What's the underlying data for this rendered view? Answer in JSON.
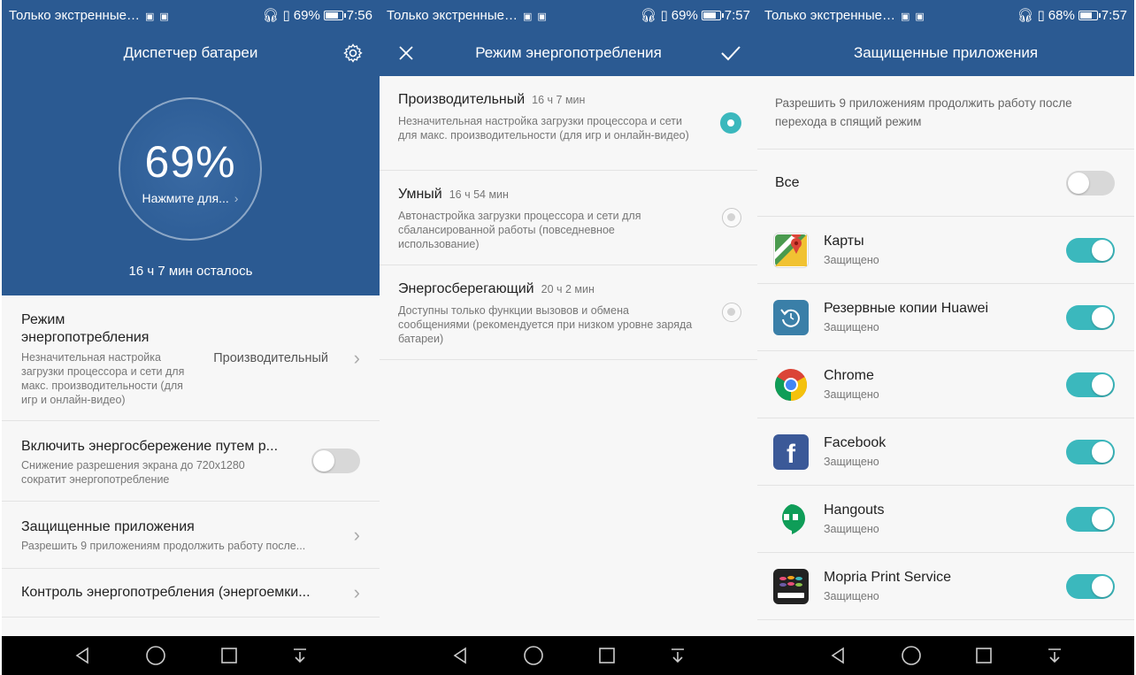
{
  "status_bars": [
    {
      "carrier": "Только экстренные…",
      "battery": "69%",
      "time": "7:56",
      "level": 0.69
    },
    {
      "carrier": "Только экстренные…",
      "battery": "69%",
      "time": "7:57",
      "level": 0.69
    },
    {
      "carrier": "Только экстренные…",
      "battery": "68%",
      "time": "7:57",
      "level": 0.68
    }
  ],
  "screen1": {
    "title": "Диспетчер батареи",
    "percent": "69%",
    "tap_label": "Нажмите для...",
    "remaining": "16 ч 7 мин осталось",
    "power_mode": {
      "title": "Режим энергопотребления",
      "desc": "Незначительная настройка загрузки процессора и сети для макс. производительности (для игр и онлайн-видео)",
      "value": "Производительный"
    },
    "resolution": {
      "title": "Включить энергосбережение путем р...",
      "desc": "Снижение разрешения экрана до 720x1280 сократит энергопотребление",
      "enabled": false
    },
    "protected": {
      "title": "Защищенные приложения",
      "desc": "Разрешить 9 приложениям продолжить работу после..."
    },
    "consumption": {
      "title": "Контроль энергопотребления (энергоемки..."
    }
  },
  "screen2": {
    "title": "Режим энергопотребления",
    "modes": [
      {
        "name": "Производительный",
        "time": "16 ч 7 мин",
        "desc": "Незначительная настройка загрузки процессора и сети для макс. производительности (для игр и онлайн-видео)",
        "selected": true
      },
      {
        "name": "Умный",
        "time": "16 ч 54 мин",
        "desc": "Автонастройка загрузки процессора и сети для сбалансированной работы (повседневное использование)",
        "selected": false
      },
      {
        "name": "Энергосберегающий",
        "time": "20 ч 2 мин",
        "desc": "Доступны только функции вызовов и обмена сообщениями (рекомендуется при низком уровне заряда батареи)",
        "selected": false
      }
    ]
  },
  "screen3": {
    "title": "Защищенные приложения",
    "intro": "Разрешить 9 приложениям продолжить работу после перехода в спящий режим",
    "all_label": "Все",
    "all_enabled": false,
    "apps": [
      {
        "name": "Карты",
        "status": "Защищено",
        "icon": "maps-icon",
        "enabled": true
      },
      {
        "name": "Резервные копии Huawei",
        "status": "Защищено",
        "icon": "backup-icon",
        "enabled": true
      },
      {
        "name": "Chrome",
        "status": "Защищено",
        "icon": "chrome-icon",
        "enabled": true
      },
      {
        "name": "Facebook",
        "status": "Защищено",
        "icon": "facebook-icon",
        "enabled": true
      },
      {
        "name": "Hangouts",
        "status": "Защищено",
        "icon": "hangouts-icon",
        "enabled": true
      },
      {
        "name": "Mopria Print Service",
        "status": "Защищено",
        "icon": "mopria-icon",
        "enabled": true
      }
    ]
  },
  "colors": {
    "brand": "#2b5a92",
    "accent": "#3bb8bd"
  }
}
